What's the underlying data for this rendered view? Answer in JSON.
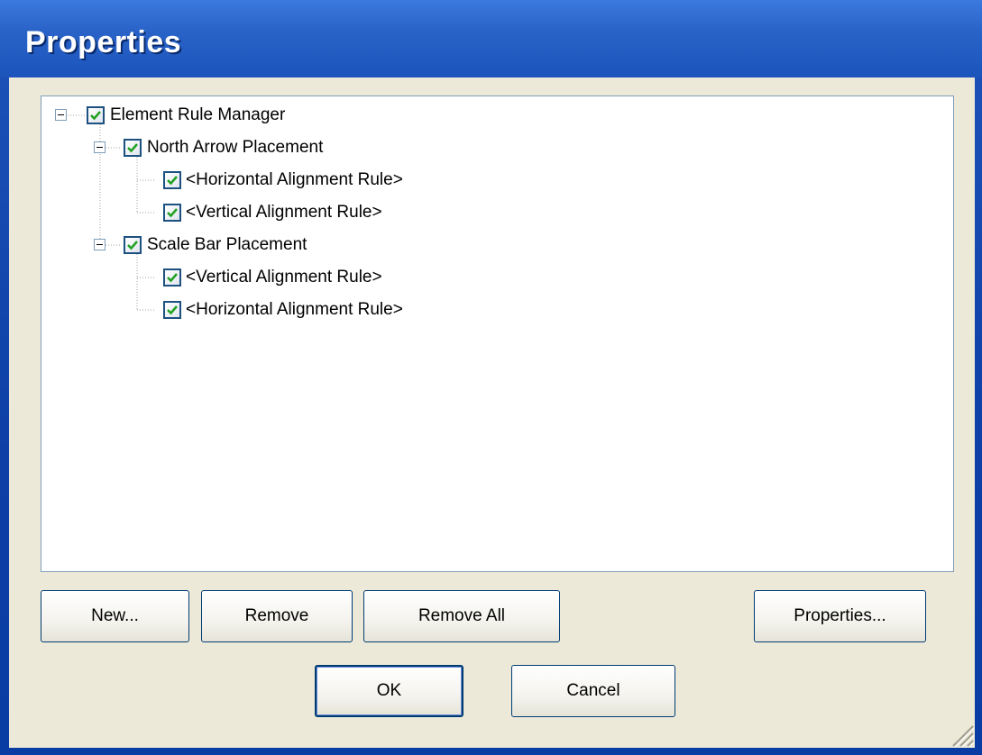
{
  "window": {
    "title": "Properties"
  },
  "tree": {
    "root": {
      "label": "Element Rule Manager",
      "checked": true,
      "expanded": true
    },
    "groups": [
      {
        "label": "North Arrow Placement",
        "checked": true,
        "expanded": true,
        "rules": [
          {
            "label": "<Horizontal Alignment Rule>",
            "checked": true
          },
          {
            "label": "<Vertical Alignment Rule>",
            "checked": true
          }
        ]
      },
      {
        "label": "Scale Bar Placement",
        "checked": true,
        "expanded": true,
        "rules": [
          {
            "label": "<Vertical Alignment Rule>",
            "checked": true
          },
          {
            "label": "<Horizontal Alignment Rule>",
            "checked": true
          }
        ]
      }
    ]
  },
  "buttons": {
    "new": "New...",
    "remove": "Remove",
    "remove_all": "Remove All",
    "properties": "Properties...",
    "ok": "OK",
    "cancel": "Cancel"
  },
  "colors": {
    "titlebar": "#2a63c8",
    "client_bg": "#ece9d8",
    "checkmark": "#21a121",
    "checkbox_border": "#1c5180"
  }
}
